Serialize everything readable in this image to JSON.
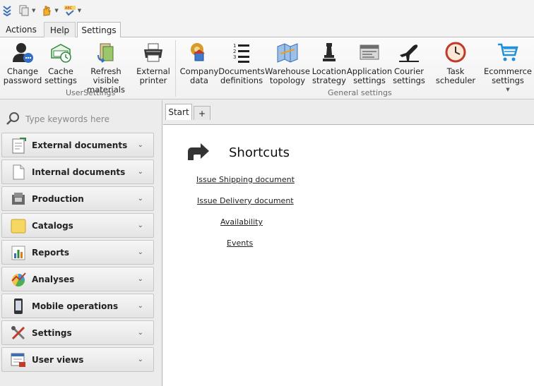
{
  "tabs": [
    "Actions",
    "Help",
    "Settings"
  ],
  "ribbon": {
    "user_settings": {
      "group_label": "UserSettings",
      "buttons": [
        {
          "label": "Change\npassword",
          "icon": "user-password-icon"
        },
        {
          "label": "Cache\nsettings",
          "icon": "cache-icon"
        },
        {
          "label": "Refresh visible\nmaterials",
          "icon": "refresh-materials-icon"
        },
        {
          "label": "External\nprinter",
          "icon": "printer-icon"
        }
      ]
    },
    "general_settings": {
      "group_label": "General settings",
      "buttons": [
        {
          "label": "Company\ndata",
          "icon": "company-icon"
        },
        {
          "label": "Documents\ndefinitions",
          "icon": "numbered-list-icon"
        },
        {
          "label": "Warehouse\ntopology",
          "icon": "map-icon"
        },
        {
          "label": "Location\nstrategy",
          "icon": "chess-piece-icon"
        },
        {
          "label": "Application\nsettings",
          "icon": "app-settings-icon"
        },
        {
          "label": "Courier\nsettings",
          "icon": "airplane-icon"
        },
        {
          "label": "Task scheduler",
          "icon": "clock-icon"
        },
        {
          "label": "Ecommerce\nsettings",
          "icon": "cart-icon"
        }
      ]
    }
  },
  "sidebar": {
    "search_placeholder": "Type keywords here",
    "items": [
      {
        "label": "External documents",
        "icon": "external-document-icon"
      },
      {
        "label": "Internal documents",
        "icon": "internal-document-icon"
      },
      {
        "label": "Production",
        "icon": "production-icon"
      },
      {
        "label": "Catalogs",
        "icon": "catalog-icon"
      },
      {
        "label": "Reports",
        "icon": "reports-icon"
      },
      {
        "label": "Analyses",
        "icon": "analyses-icon"
      },
      {
        "label": "Mobile operations",
        "icon": "mobile-icon"
      },
      {
        "label": "Settings",
        "icon": "tools-icon"
      },
      {
        "label": "User views",
        "icon": "user-views-icon"
      }
    ]
  },
  "main": {
    "doc_tabs": [
      "Start",
      "+"
    ],
    "shortcuts_title": "Shortcuts",
    "links": [
      "Issue Shipping document",
      "Issue Delivery document",
      "Availability",
      "Events"
    ]
  }
}
